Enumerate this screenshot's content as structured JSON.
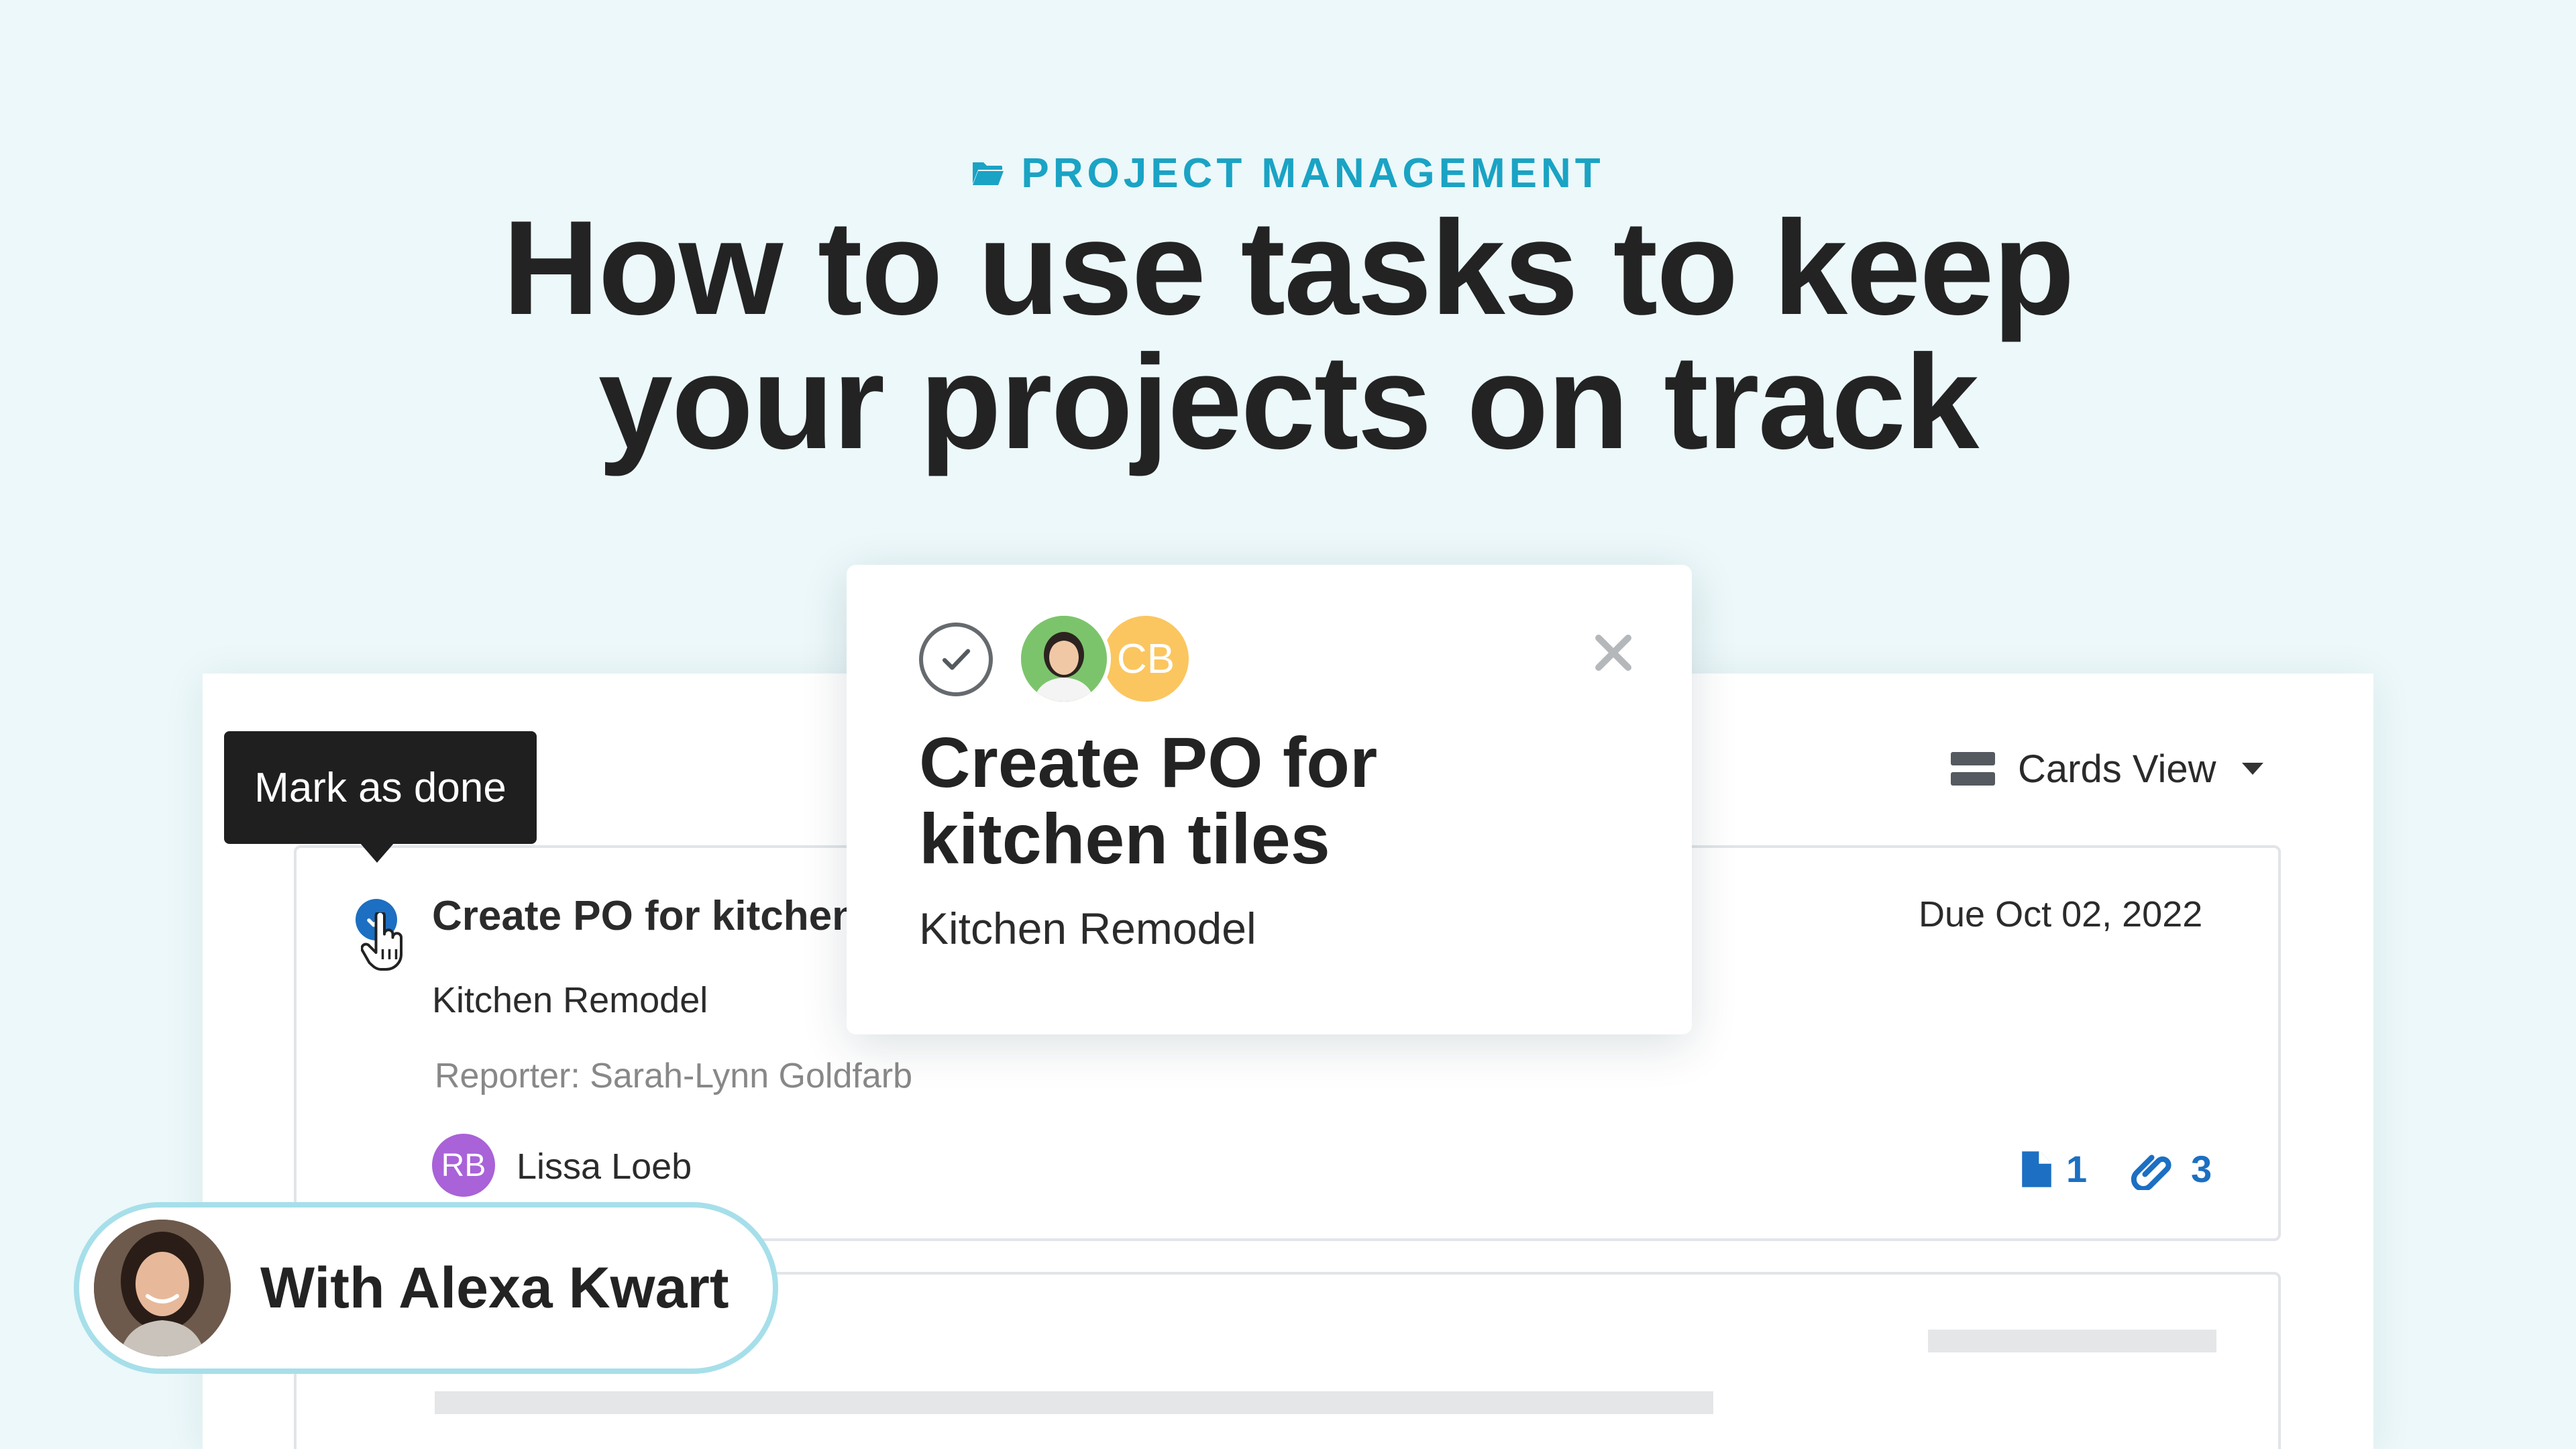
{
  "header": {
    "category": "PROJECT MANAGEMENT",
    "title_line1": "How to use tasks to keep",
    "title_line2": "your projects on track"
  },
  "toolbar": {
    "view_label": "Cards View",
    "view_icon": "cards-view-icon"
  },
  "tooltip": {
    "text": "Mark as done"
  },
  "task": {
    "title": "Create PO for kitchen",
    "project": "Kitchen Remodel",
    "reporter": "Reporter: Sarah-Lynn Goldfarb",
    "due": "Due Oct 02, 2022",
    "assignee_initials": "RB",
    "assignee_name": "Lissa Loeb",
    "files_count": "1",
    "links_count": "3"
  },
  "popup": {
    "title": "Create PO for kitchen tiles",
    "project": "Kitchen Remodel",
    "avatar_initials": "CB"
  },
  "presenter": {
    "name": "With Alexa Kwart"
  },
  "colors": {
    "background": "#ecf8fa",
    "accent": "#1aa3c4",
    "link_blue": "#1c6fc2",
    "assignee_purple": "#a962d8",
    "avatar_yellow": "#fbc65f",
    "pill_border": "#a6dfea"
  }
}
